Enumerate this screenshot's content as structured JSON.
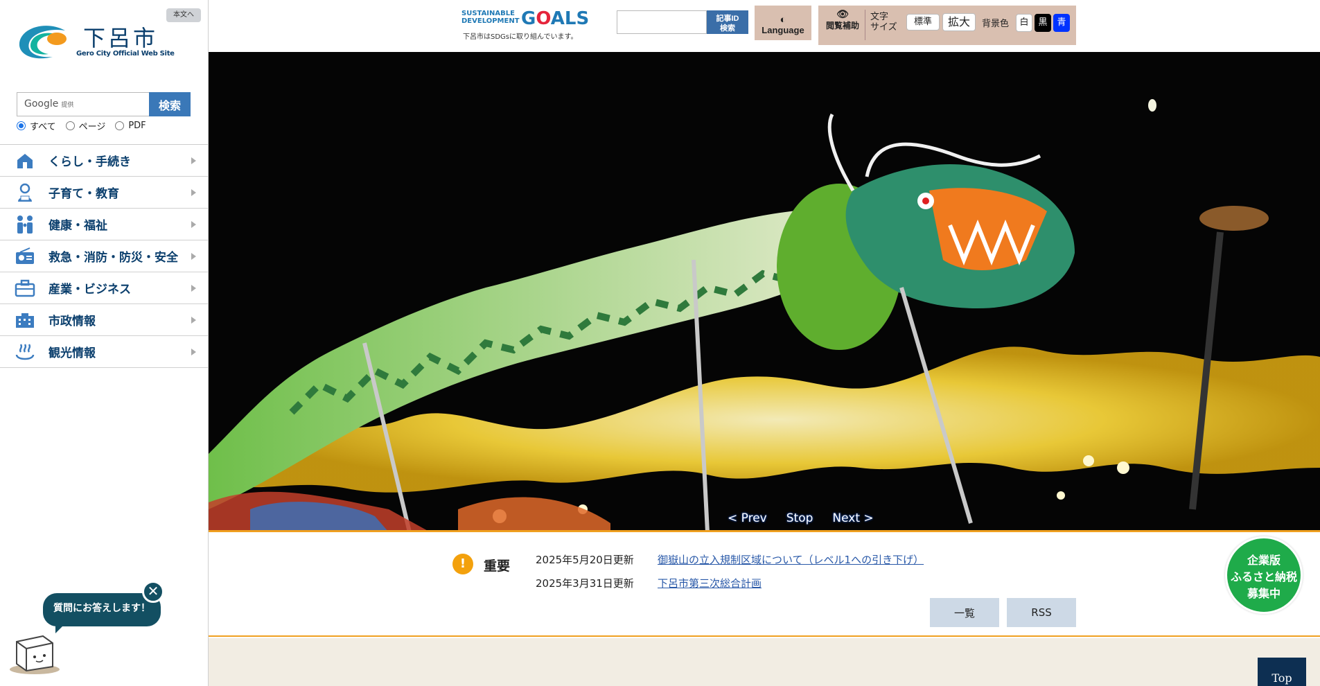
{
  "sidebar": {
    "skip_link": "本文へ",
    "logo_title": "下呂市",
    "logo_subtitle": "Gero City Official Web Site",
    "search_brand": "Google",
    "search_brand_sub": "提供",
    "search_button": "検索",
    "scope_options": [
      "すべて",
      "ページ",
      "PDF"
    ],
    "scope_selected": "すべて",
    "nav": [
      {
        "label": "くらし・手続き",
        "icon": "house-icon"
      },
      {
        "label": "子育て・教育",
        "icon": "child-icon"
      },
      {
        "label": "健康・福祉",
        "icon": "family-icon"
      },
      {
        "label": "救急・消防・防災・安全",
        "icon": "radio-icon"
      },
      {
        "label": "産業・ビジネス",
        "icon": "briefcase-icon"
      },
      {
        "label": "市政情報",
        "icon": "building-icon"
      },
      {
        "label": "観光情報",
        "icon": "hot-spring-icon"
      }
    ],
    "chatbot_text": "質問にお答えします！",
    "chatbot_close": "✕"
  },
  "header": {
    "sdgs_line1": "SUSTAINABLE",
    "sdgs_line2": "DEVELOPMENT",
    "sdgs_goals_g": "G",
    "sdgs_goals_o": "O",
    "sdgs_goals_rest": "ALS",
    "sdgs_note": "下呂市はSDGsに取り組んでいます。",
    "article_id_line1": "記事ID",
    "article_id_line2": "検索",
    "language_label": "Language",
    "browse_aid_label": "閲覧補助",
    "text_size_label_1": "文字",
    "text_size_label_2": "サイズ",
    "size_normal": "標準",
    "size_large": "拡大",
    "bg_color_label": "背景色",
    "bg_white": "白",
    "bg_black": "黒",
    "bg_blue": "青"
  },
  "hero": {
    "prev": "< Prev",
    "stop": "Stop",
    "next": "Next >"
  },
  "news": {
    "important_label": "重要",
    "important_mark": "!",
    "items": [
      {
        "date": "2025年5月20日更新",
        "title": "御嶽山の立入規制区域について（レベル1への引き下げ）"
      },
      {
        "date": "2025年3月31日更新",
        "title": "下呂市第三次総合計画"
      }
    ],
    "list_button": "一覧",
    "rss_button": "RSS"
  },
  "furusato": [
    "企業版",
    "ふるさと納税",
    "募集中"
  ],
  "top_button": "Top",
  "colors": {
    "brand_navy": "#0b3f6d",
    "accent_orange": "#f0a020",
    "access_panel_bg": "#d9bfb0",
    "furusato_green": "#1fab4a"
  }
}
